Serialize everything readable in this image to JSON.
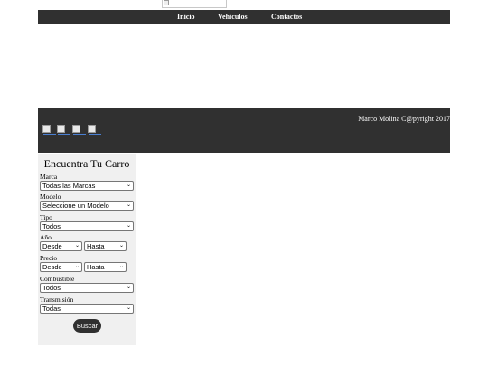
{
  "nav": {
    "items": [
      {
        "label": "Inicio"
      },
      {
        "label": "Vehiculos"
      },
      {
        "label": "Contactos"
      }
    ]
  },
  "footer": {
    "copyright": "Marco Molina C@pyright 2017",
    "social_icons": [
      "social-icon-1",
      "social-icon-2",
      "social-icon-3",
      "social-icon-4"
    ]
  },
  "search_panel": {
    "title": "Encuentra Tu Carro",
    "marca": {
      "label": "Marca",
      "value": "Todas las Marcas"
    },
    "modelo": {
      "label": "Modelo",
      "value": "Seleccione un Modelo"
    },
    "tipo": {
      "label": "Tipo",
      "value": "Todos"
    },
    "anio": {
      "label": "Año",
      "from": "Desde",
      "to": "Hasta"
    },
    "precio": {
      "label": "Precio",
      "from": "Desde",
      "to": "Hasta"
    },
    "combustible": {
      "label": "Combustible",
      "value": "Todos"
    },
    "transmision": {
      "label": "Transmisión",
      "value": "Todas"
    },
    "button_label": "Buscar"
  }
}
